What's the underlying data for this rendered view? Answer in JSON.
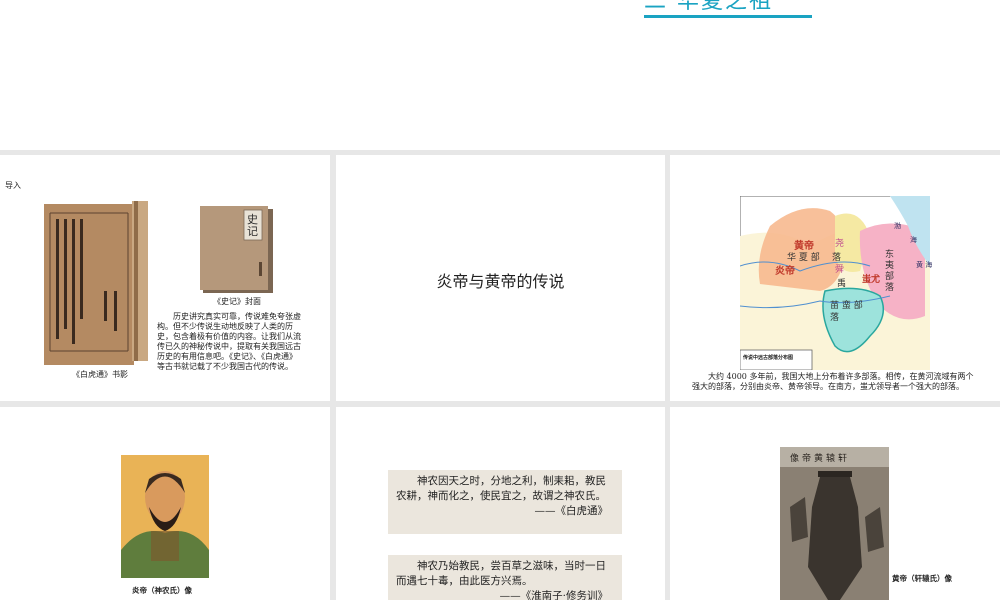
{
  "header": {
    "cut_title": "二 华夏之祖"
  },
  "slide1": {
    "label": "导入",
    "book1_caption": "《白虎通》书影",
    "book2_title": "史记",
    "book2_caption": "《史记》封面",
    "body": "历史讲究真实可靠，传说难免夸张虚构。但不少传说生动地反映了人类的历史，包含着极有价值的内容。让我们从流传已久的神秘传说中，提取有关我国远古历史的有用信息吧。《史记》、《白虎通》等古书就记载了不少我国古代的传说。"
  },
  "slide2": {
    "title": "炎帝与黄帝的传说"
  },
  "slide3": {
    "map": {
      "huangdi": "黄帝",
      "yandi": "炎帝",
      "huaxia": "华 夏 部",
      "yao": "尧",
      "shun": "舜",
      "luo": "落",
      "yu": "禹",
      "chiyou": "蚩尤",
      "dongyi": "东 夷 部 落",
      "miaoman": "苗 蛮 部 落",
      "bohai": "渤",
      "hai": "海",
      "huanghai": "黄 海",
      "legend": "传说中远古部落分布图"
    },
    "caption": "大约 4000 多年前，我国大地上分布着许多部落。相传，在黄河流域有两个强大的部落，分别由炎帝、黄帝领导。在南方，蚩尤领导者一个强大的部落。"
  },
  "slide4": {
    "caption": "炎帝（神农氏）像"
  },
  "slide5": {
    "quote1": "神农因天之时，分地之利，制耒耜，教民农耕，神而化之，使民宜之，故谓之神农氏。",
    "quote1_src": "——《白虎通》",
    "quote2": "神农乃始教民，尝百草之滋味，当时一日而遇七十毒，由此医方兴焉。",
    "quote2_src": "——《淮南子·修务训》"
  },
  "slide6": {
    "banner": "轩辕黄帝像",
    "caption": "黄帝（轩辕氏）像"
  }
}
